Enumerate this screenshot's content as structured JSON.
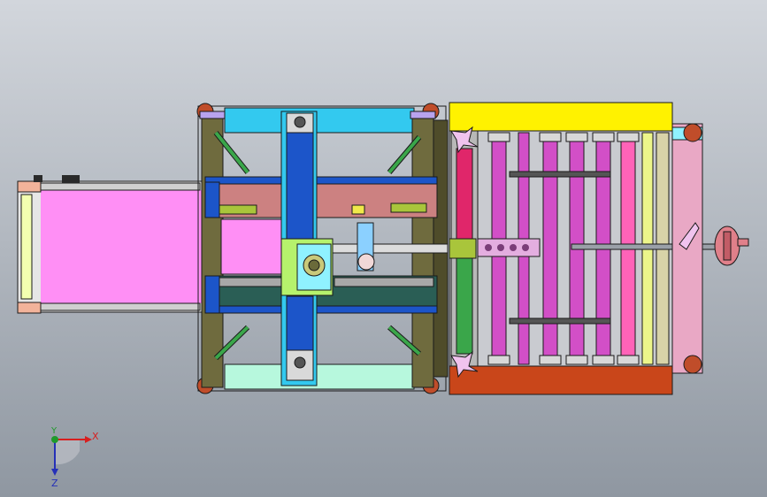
{
  "view": {
    "background": {
      "top": "#d2d6dc",
      "bottom": "#8f97a1"
    }
  },
  "triad": {
    "x_label": "X",
    "y_label": "Y",
    "z_label": "Z",
    "colors": {
      "x": "#d81f1f",
      "y": "#1f9a2b",
      "z": "#2530b8"
    }
  },
  "palette": {
    "outline": "#1a1a1a",
    "frame_olive": "#6f6b3e",
    "frame_olive_dark": "#4f4c2a",
    "frame_green": "#4e7f3e",
    "cyan": "#33c9ef",
    "cyan_light": "#8ff2ff",
    "lavender": "#b8a3ee",
    "pink_belt": "#ff8ff5",
    "yellow": "#fff200",
    "red_brown": "#c9461a",
    "magenta_roller": "#d24fc7",
    "pink_roller": "#ff63b8",
    "mint": "#b7f8dd",
    "light_blue": "#8bd0ff",
    "blue": "#1c55c9",
    "dark_teal": "#2a5e55",
    "salmon": "#cc8181",
    "olive_green": "#a9c53b",
    "lime": "#b6f26c",
    "gray": "#a8a8a8",
    "crimson": "#e0266a",
    "green_roller": "#3aa64a",
    "beige": "#d8d3a8"
  }
}
